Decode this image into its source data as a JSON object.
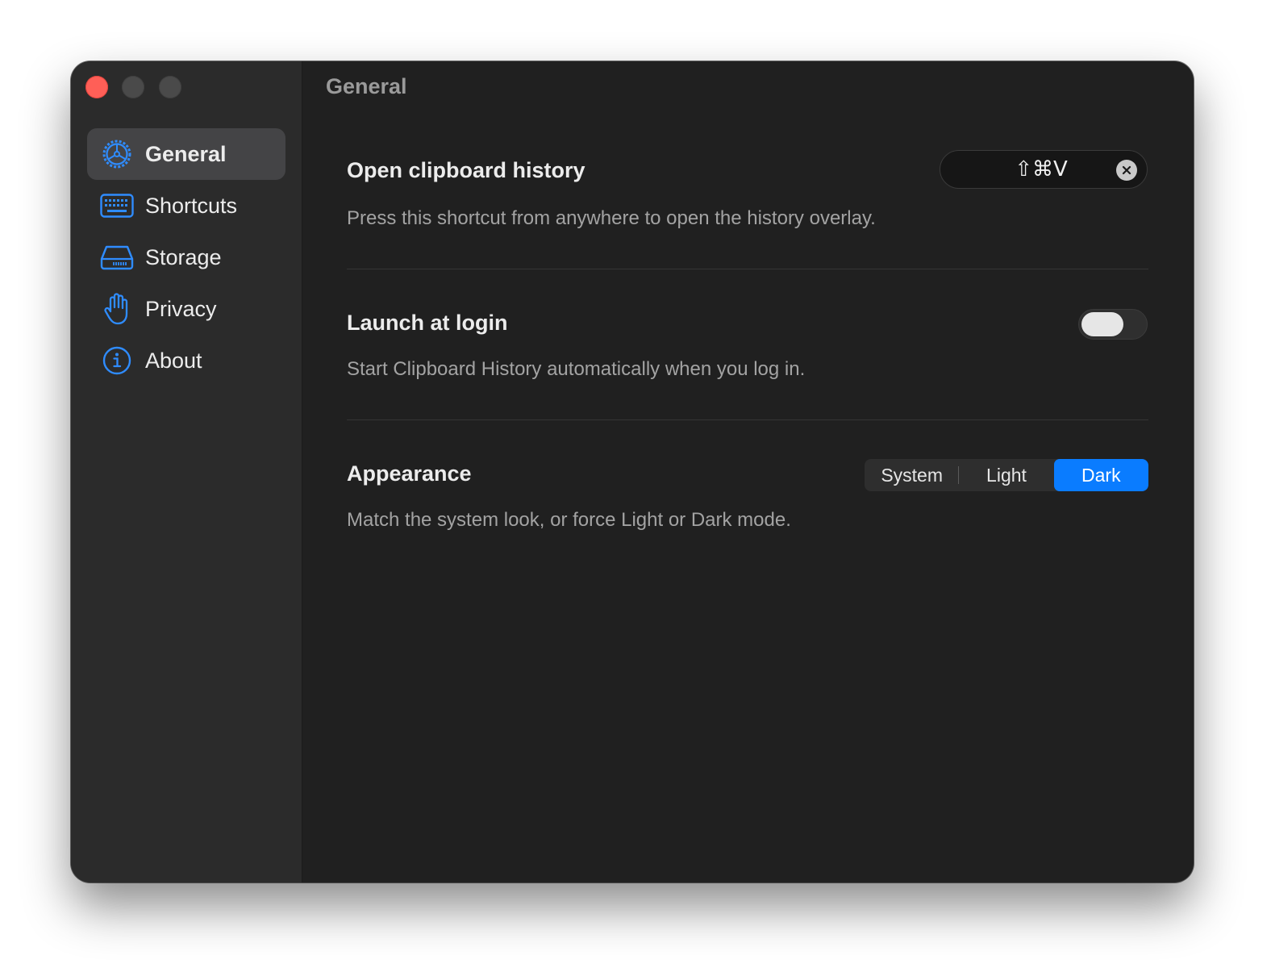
{
  "window": {
    "title": "General"
  },
  "sidebar": {
    "items": [
      {
        "label": "General",
        "icon": "gear-icon",
        "active": true
      },
      {
        "label": "Shortcuts",
        "icon": "keyboard-icon",
        "active": false
      },
      {
        "label": "Storage",
        "icon": "storage-drive-icon",
        "active": false
      },
      {
        "label": "Privacy",
        "icon": "hand-icon",
        "active": false
      },
      {
        "label": "About",
        "icon": "info-icon",
        "active": false
      }
    ]
  },
  "settings": {
    "clipboard": {
      "title": "Open clipboard history",
      "description": "Press this shortcut from anywhere to open the history overlay.",
      "shortcut": "⇧⌘V"
    },
    "launch": {
      "title": "Launch at login",
      "description": "Start Clipboard History automatically when you log in.",
      "enabled": false
    },
    "appearance": {
      "title": "Appearance",
      "description": "Match the system look, or force Light or Dark mode.",
      "options": [
        "System",
        "Light",
        "Dark"
      ],
      "selected": "Dark"
    }
  },
  "colors": {
    "accent": "#0a7cff",
    "close": "#ff5f57",
    "window_bg": "#202020",
    "sidebar_bg": "#2b2b2b"
  }
}
